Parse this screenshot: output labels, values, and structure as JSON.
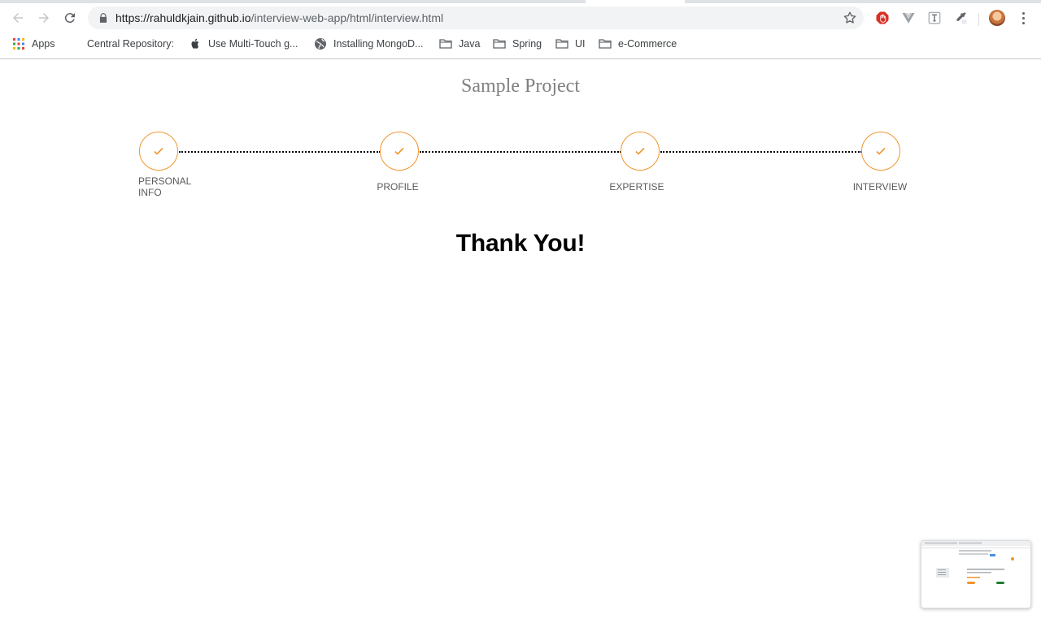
{
  "browser": {
    "url_host": "https://rahuldkjain.github.io",
    "url_path": "/interview-web-app/html/interview.html",
    "nav_icons": [
      "back-arrow-icon",
      "forward-arrow-icon",
      "reload-icon"
    ],
    "extension_icons": [
      "adblock-icon",
      "vuejs-devtools-icon",
      "text-tool-icon",
      "eyedropper-icon"
    ]
  },
  "bookmarks": {
    "items": [
      {
        "label": "Apps",
        "icon": "apps-grid-icon"
      },
      {
        "label": "Central Repository:",
        "icon": ""
      },
      {
        "label": "Use Multi-Touch g...",
        "icon": "apple-icon"
      },
      {
        "label": "Installing MongoD...",
        "icon": "globe-icon"
      },
      {
        "label": "Java",
        "icon": "folder-icon"
      },
      {
        "label": "Spring",
        "icon": "folder-icon"
      },
      {
        "label": "UI",
        "icon": "folder-icon"
      },
      {
        "label": "e-Commerce",
        "icon": "folder-icon"
      }
    ]
  },
  "page": {
    "title": "Sample Project",
    "steps": [
      {
        "label": "Personal Info",
        "status": "complete"
      },
      {
        "label": "Profile",
        "status": "complete"
      },
      {
        "label": "Expertise",
        "status": "complete"
      },
      {
        "label": "Interview",
        "status": "complete"
      }
    ],
    "message": "Thank You!",
    "accent_color": "#f0962e"
  }
}
